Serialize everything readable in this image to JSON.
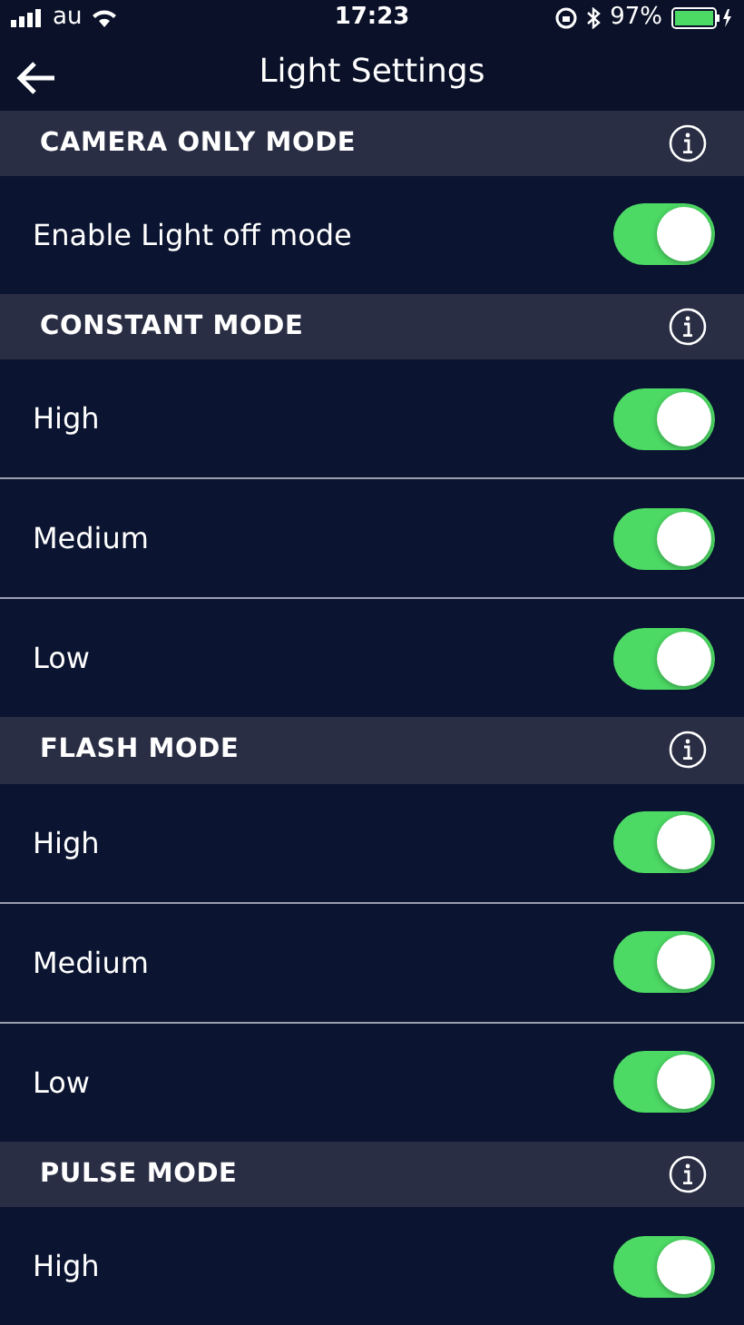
{
  "status_bar": {
    "carrier": "au",
    "time": "17:23",
    "battery": "97%"
  },
  "nav": {
    "title": "Light Settings"
  },
  "sections": [
    {
      "title": "CAMERA ONLY MODE",
      "rows": [
        {
          "label": "Enable Light off mode",
          "on": true
        }
      ]
    },
    {
      "title": "CONSTANT MODE",
      "rows": [
        {
          "label": "High",
          "on": true
        },
        {
          "label": "Medium",
          "on": true
        },
        {
          "label": "Low",
          "on": true
        }
      ]
    },
    {
      "title": "FLASH MODE",
      "rows": [
        {
          "label": "High",
          "on": true
        },
        {
          "label": "Medium",
          "on": true
        },
        {
          "label": "Low",
          "on": true
        }
      ]
    },
    {
      "title": "PULSE MODE",
      "rows": [
        {
          "label": "High",
          "on": true
        }
      ]
    }
  ]
}
